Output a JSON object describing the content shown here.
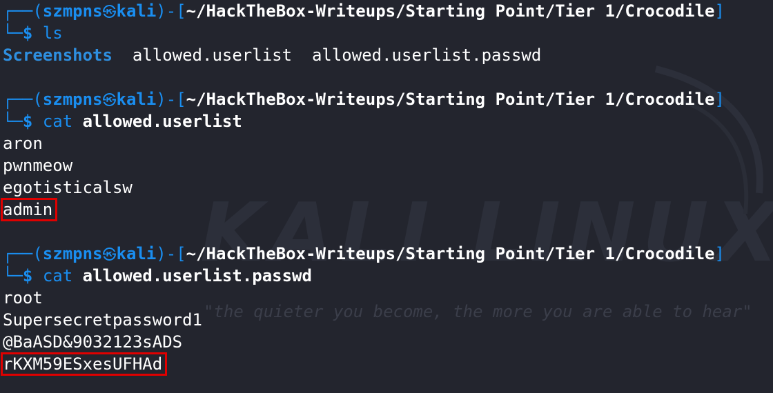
{
  "watermark": {
    "logo_text": "KALI LINUX",
    "quote": "\"the quieter you become, the more you are able to hear\""
  },
  "prompt": {
    "user": "szmpns",
    "host": "kali",
    "path": "~/HackTheBox-Writeups/Starting Point/Tier 1/Crocodile",
    "symbol": "$"
  },
  "blocks": [
    {
      "cmd": "ls",
      "arg": "",
      "ls_output": [
        "Screenshots",
        "allowed.userlist",
        "allowed.userlist.passwd"
      ]
    },
    {
      "cmd": "cat",
      "arg": "allowed.userlist",
      "lines": [
        "aron",
        "pwnmeow",
        "egotisticalsw",
        "admin"
      ]
    },
    {
      "cmd": "cat",
      "arg": "allowed.userlist.passwd",
      "lines": [
        "root",
        "Supersecretpassword1",
        "@BaASD&9032123sADS",
        "rKXM59ESxesUFHAd"
      ]
    }
  ],
  "colors": {
    "background": "#23252e",
    "prompt_blue": "#1a8ef0",
    "highlight_red": "#e00000"
  }
}
